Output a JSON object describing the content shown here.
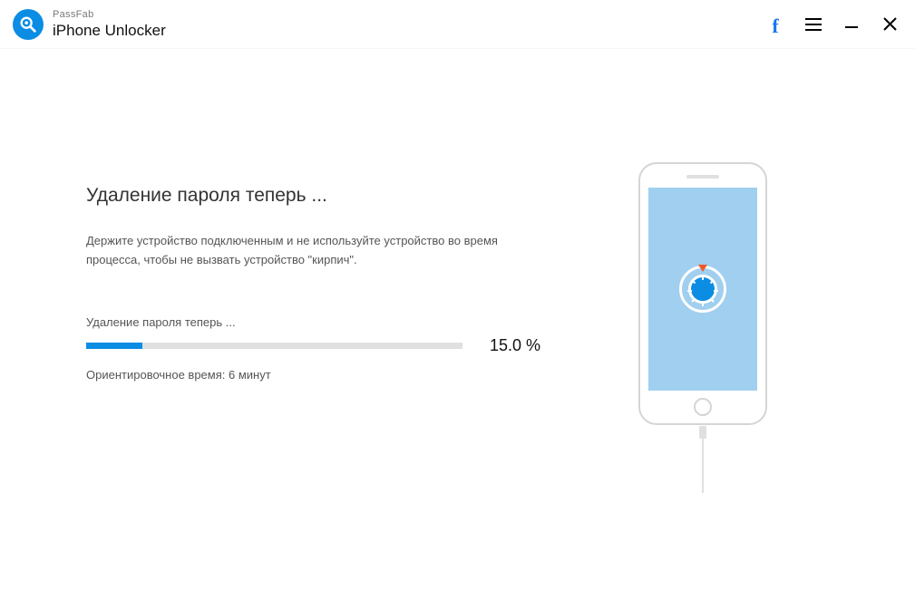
{
  "brand": {
    "small": "PassFab",
    "big": "iPhone Unlocker"
  },
  "main": {
    "heading": "Удаление пароля теперь ...",
    "description": "Держите устройство подключенным и не используйте устройство во время процесса, чтобы не вызвать устройство \"кирпич\".",
    "progress_label": "Удаление пароля теперь ...",
    "progress_pct_value": 15.0,
    "progress_pct_display": "15.0 %",
    "eta": "Ориентировочное время: 6 минут"
  },
  "colors": {
    "accent": "#0b8de4",
    "screen": "#a0cfef"
  }
}
